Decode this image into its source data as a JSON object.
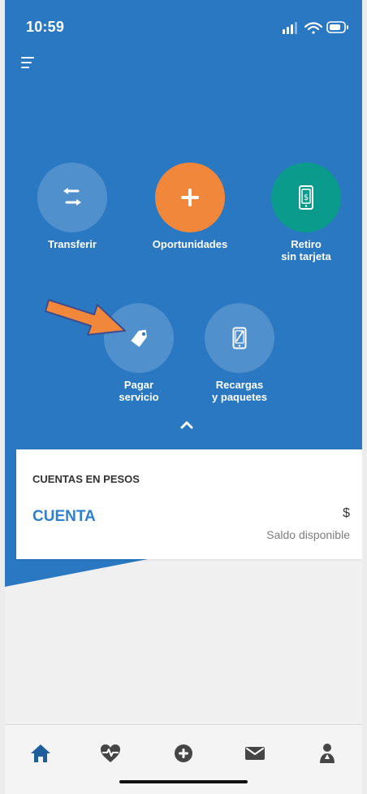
{
  "status_bar": {
    "time": "10:59"
  },
  "actions": {
    "transfer": "Transferir",
    "opportunities": "Oportunidades",
    "cardless_withdrawal": "Retiro\nsin tarjeta",
    "pay_service": "Pagar\nservicio",
    "topups": "Recargas\ny paquetes"
  },
  "accounts": {
    "section_title": "CUENTAS EN PESOS",
    "account_name": "CUENTA",
    "amount_prefix": "$",
    "balance_label": "Saldo disponible"
  },
  "colors": {
    "brand_blue": "#2a78c1",
    "accent_orange": "#f0873b",
    "teal": "#0b9b8c",
    "link_blue": "#2f7fd1"
  },
  "icons": {
    "transfer": "transfer-icon",
    "opportunities": "plus-icon",
    "cardless_withdrawal": "mobile-cash-icon",
    "pay_service": "tag-icon",
    "topups": "phone-topup-icon",
    "home": "home-icon",
    "health": "heart-pulse-icon",
    "create": "plus-circle-icon",
    "messages": "mail-icon",
    "profile": "profile-icon"
  }
}
